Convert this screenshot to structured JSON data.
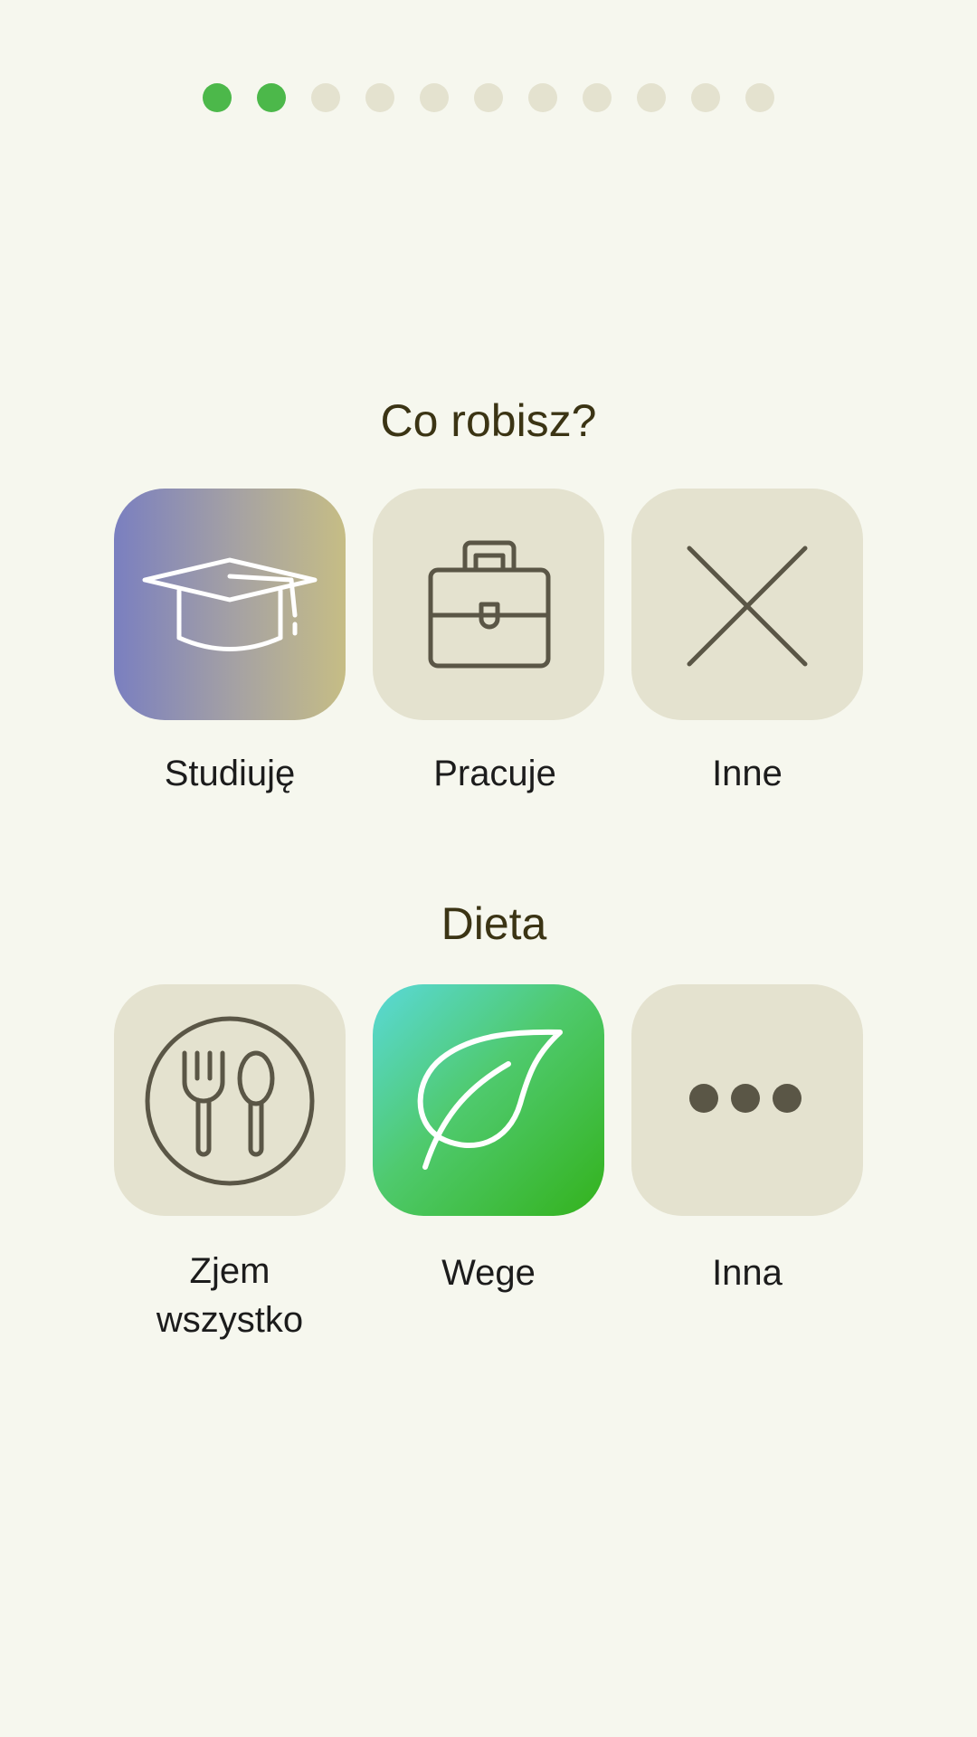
{
  "progress": {
    "total_steps": 11,
    "completed_steps": 2,
    "active_color": "#4cb84a",
    "inactive_color": "#e4e2cf"
  },
  "occupation": {
    "title": "Co robisz?",
    "options": [
      {
        "label": "Studiuję",
        "icon": "graduation-cap-icon",
        "selected": true
      },
      {
        "label": "Pracuje",
        "icon": "briefcase-icon",
        "selected": false
      },
      {
        "label": "Inne",
        "icon": "x-icon",
        "selected": false
      }
    ]
  },
  "diet": {
    "title": "Dieta",
    "options": [
      {
        "label_line1": "Zjem",
        "label_line2": "wszystko",
        "icon": "plate-fork-spoon-icon",
        "selected": false
      },
      {
        "label": "Wege",
        "icon": "leaf-icon",
        "selected": true
      },
      {
        "label": "Inna",
        "icon": "more-dots-icon",
        "selected": false
      }
    ]
  },
  "colors": {
    "background": "#f6f7ee",
    "tile": "#e4e2cf",
    "icon_stroke": "#5a5646",
    "title_text": "#3b3414"
  }
}
